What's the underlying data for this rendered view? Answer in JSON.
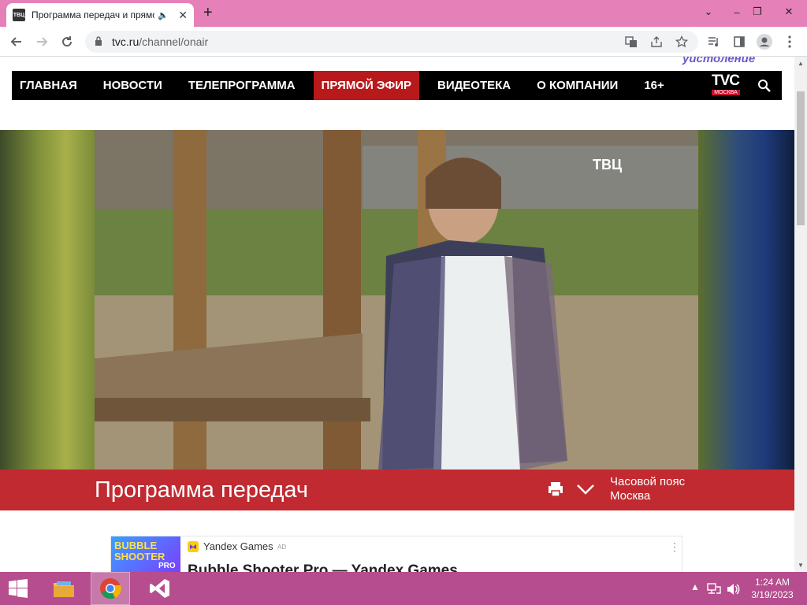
{
  "browser": {
    "tab": {
      "favicon_text": "ТВЦ",
      "title": "Программа передач и прямой эфир",
      "speaker": "🔈",
      "close": "✕"
    },
    "new_tab": "+",
    "window_controls": {
      "chevron": "⌄",
      "minimize": "–",
      "restore": "❐",
      "close": "✕"
    },
    "url_host": "tvc.ru",
    "url_path": "/channel/onair"
  },
  "site": {
    "decor_text": "уистоление",
    "nav": [
      {
        "label": "ГЛАВНАЯ"
      },
      {
        "label": "НОВОСТИ"
      },
      {
        "label": "ТЕЛЕПРОГРАММА"
      },
      {
        "label": "ПРЯМОЙ ЭФИР"
      },
      {
        "label": "ВИДЕОТЕКА"
      },
      {
        "label": "О КОМПАНИИ"
      },
      {
        "label": "16+"
      }
    ],
    "logo_big": "TVC",
    "logo_small": "МОСКВА"
  },
  "player": {
    "channel_mark": "ТВЦ"
  },
  "schedule": {
    "title": "Программа передач",
    "timezone_label": "Часовой пояс",
    "timezone_value": "Москва"
  },
  "ad": {
    "thumb_line1": "BUBBLE",
    "thumb_line2": "SHOOTER",
    "thumb_line3": "PRO",
    "source": "Yandex Games",
    "ad_label": "AD",
    "headline": "Bubble Shooter Pro — Yandex Games",
    "menu": "⋮"
  },
  "taskbar": {
    "time": "1:24 AM",
    "date": "3/19/2023"
  },
  "colors": {
    "accent": "#b8191b",
    "tab_strip": "#e580b8",
    "taskbar": "#b54d8e"
  }
}
